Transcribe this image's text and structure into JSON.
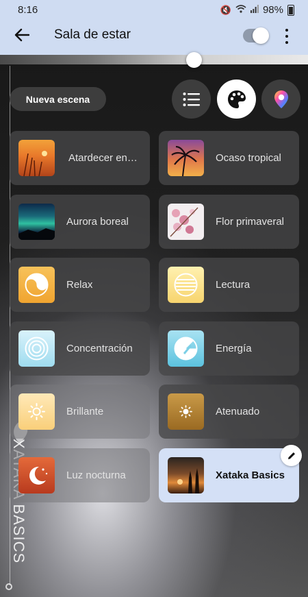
{
  "status_bar": {
    "time": "8:16",
    "battery": "98%"
  },
  "header": {
    "title": "Sala de estar"
  },
  "toolbar": {
    "new_scene_label": "Nueva escena"
  },
  "scenes": [
    {
      "label": "Atardecer en…"
    },
    {
      "label": "Ocaso tropical"
    },
    {
      "label": "Aurora boreal"
    },
    {
      "label": "Flor primaveral"
    },
    {
      "label": "Relax"
    },
    {
      "label": "Lectura"
    },
    {
      "label": "Concentración"
    },
    {
      "label": "Energía"
    },
    {
      "label": "Brillante"
    },
    {
      "label": "Atenuado"
    },
    {
      "label": "Luz nocturna"
    },
    {
      "label": "Xataka Basics"
    }
  ],
  "brightness": {
    "value": 0.63
  },
  "watermark": {
    "text": "XATAKA BASICS"
  },
  "colors": {
    "header_bg": "#cfdcf2",
    "active_tile_bg": "#d4e0f6"
  }
}
